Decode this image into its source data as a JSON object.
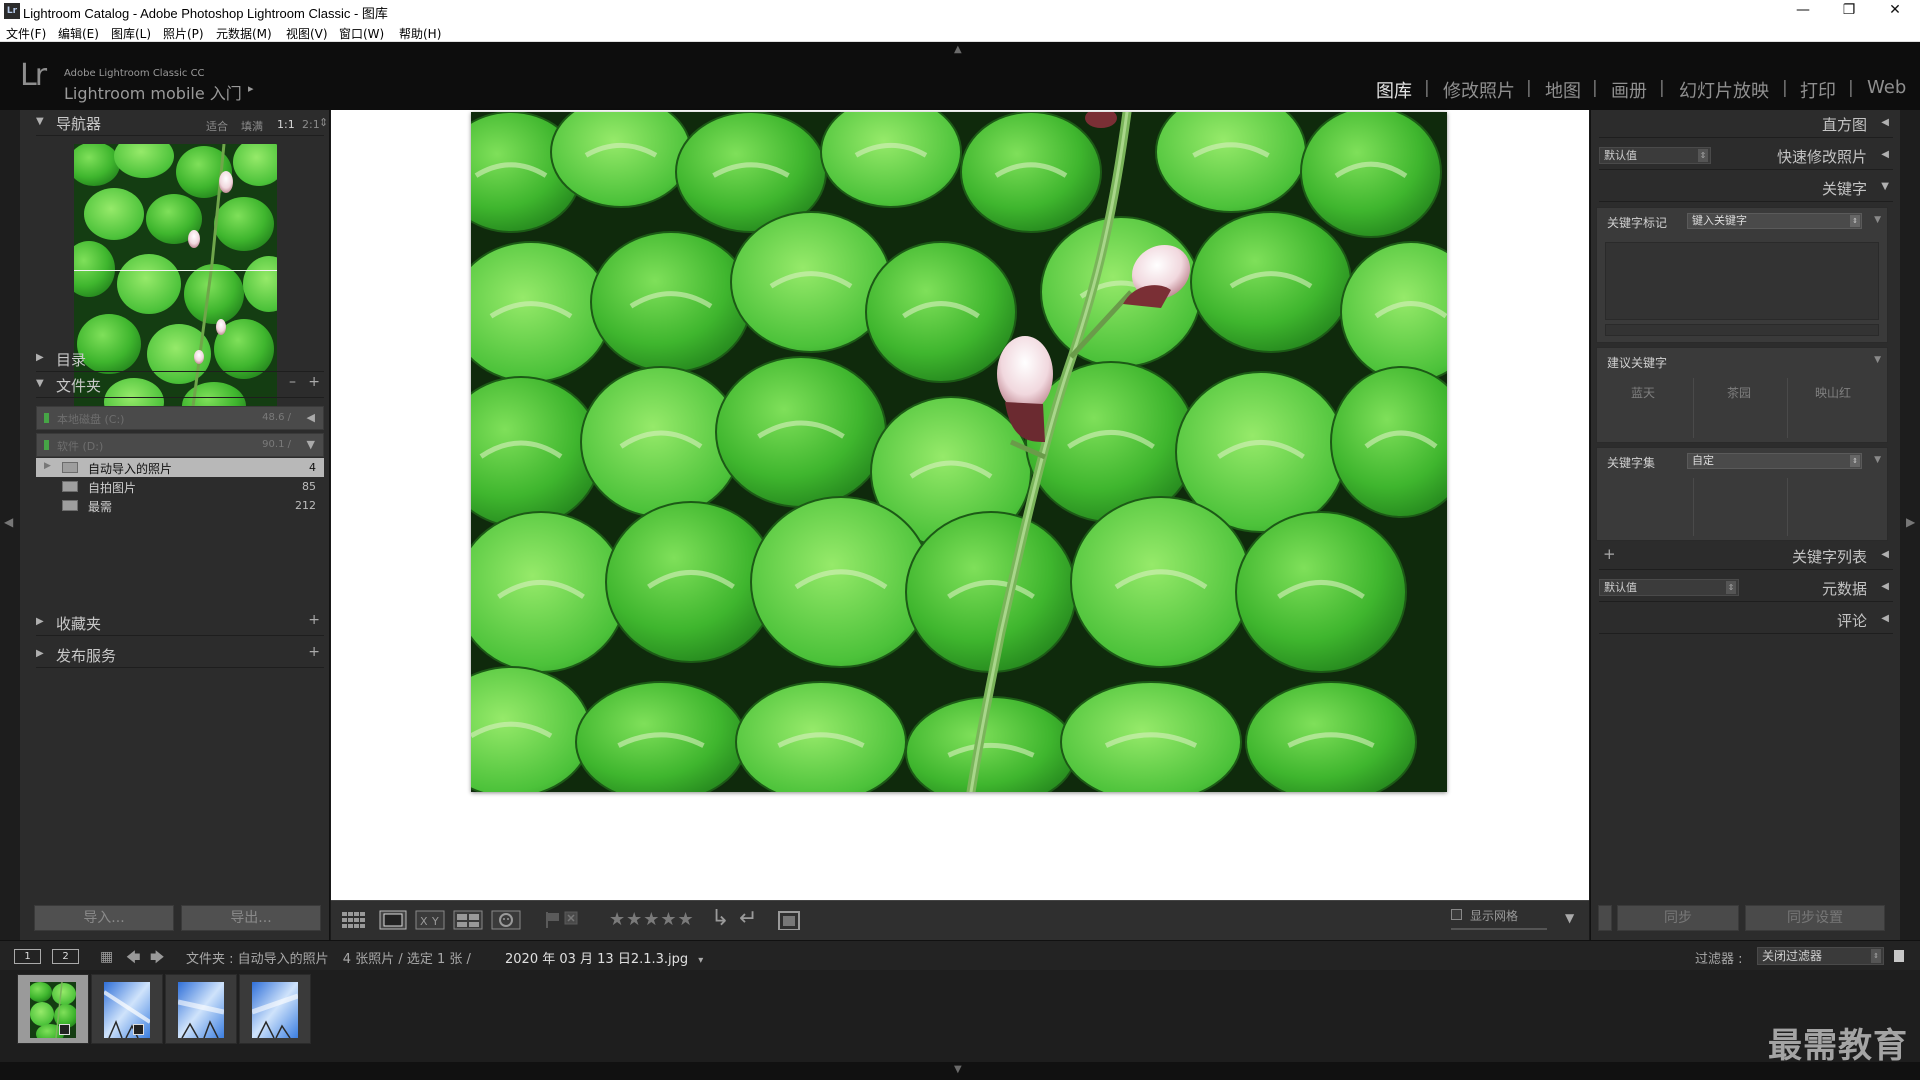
{
  "window": {
    "title": "Lightroom Catalog - Adobe Photoshop Lightroom Classic - 图库",
    "app_icon": "Lr",
    "controls": [
      "minimize",
      "restore",
      "close"
    ]
  },
  "menu": [
    "文件(F)",
    "编辑(E)",
    "图库(L)",
    "照片(P)",
    "元数据(M)",
    "视图(V)",
    "窗口(W)",
    "帮助(H)"
  ],
  "identity": {
    "logo": "Lr",
    "line1": "Adobe Lightroom Classic CC",
    "line2": "Lightroom mobile 入门",
    "arrow": "▸"
  },
  "modules": [
    "图库",
    "修改照片",
    "地图",
    "画册",
    "幻灯片放映",
    "打印",
    "Web"
  ],
  "active_module": "图库",
  "left": {
    "navigator": {
      "label": "导航器",
      "options": [
        "适合",
        "填满",
        "1:1",
        "2:1"
      ],
      "selected": "1:1"
    },
    "catalog_label": "目录",
    "folders_label": "文件夹",
    "volumes": [
      {
        "name": "本地磁盘 (C:)",
        "value": "48.6 /"
      },
      {
        "name": "软件 (D:)",
        "value": "90.1 /"
      }
    ],
    "folders": [
      {
        "name": "自动导入的照片",
        "count": "4",
        "selected": true
      },
      {
        "name": "自拍图片",
        "count": "85",
        "selected": false
      },
      {
        "name": "最需",
        "count": "212",
        "selected": false
      }
    ],
    "collections_label": "收藏夹",
    "publish_label": "发布服务",
    "import_label": "导入...",
    "export_label": "导出..."
  },
  "toolbar": {
    "stars": "★★★★★",
    "show_grid_label": "显示网格"
  },
  "right": {
    "histogram_label": "直方图",
    "quick_develop_label": "快速修改照片",
    "quick_develop_preset": "默认值",
    "keywording_label": "关键字",
    "keyword_tags_label": "关键字标记",
    "keyword_tags_value": "键入关键字",
    "suggested_label": "建议关键字",
    "suggested": [
      "蓝天",
      "茶园",
      "映山红"
    ],
    "keyword_set_label": "关键字集",
    "keyword_set_value": "自定",
    "keyword_list_label": "关键字列表",
    "metadata_label": "元数据",
    "metadata_preset": "默认值",
    "comments_label": "评论",
    "sync_label": "同步",
    "sync_settings_label": "同步设置"
  },
  "filmstrip_bar": {
    "screen1": "1",
    "screen2": "2",
    "source": "文件夹 : 自动导入的照片",
    "count": "4 张照片 / 选定 1 张 /",
    "filename": "2020 年 03 月 13 日2.1.3.jpg",
    "filename_arrow": "▾",
    "filter_label": "过滤器 :",
    "filter_value": "关闭过滤器"
  },
  "watermark": "最需教育",
  "colors": {
    "panel_bg": "#2c2c2c",
    "active_module": "#e4e4e4",
    "inactive_module": "#8f8f8f",
    "selected_folder": "#b8b8b8"
  }
}
